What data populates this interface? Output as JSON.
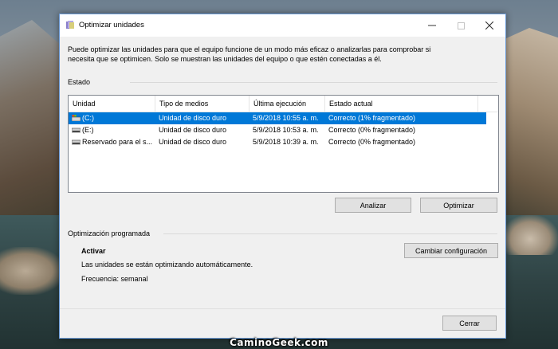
{
  "window": {
    "title": "Optimizar unidades",
    "description": "Puede optimizar las unidades para que el equipo funcione de un modo más eficaz o analizarlas para comprobar si necesita que se optimicen. Solo se muestran las unidades del equipo o que estén conectadas a él."
  },
  "status": {
    "label": "Estado",
    "columns": [
      "Unidad",
      "Tipo de medios",
      "Última ejecución",
      "Estado actual"
    ],
    "rows": [
      {
        "unit": "(C:)",
        "media": "Unidad de disco duro",
        "last_run": "5/9/2018 10:55 a. m.",
        "state": "Correcto (1% fragmentado)",
        "icon": "windows-drive-icon"
      },
      {
        "unit": "(E:)",
        "media": "Unidad de disco duro",
        "last_run": "5/9/2018 10:53 a. m.",
        "state": "Correcto (0% fragmentado)",
        "icon": "drive-icon"
      },
      {
        "unit": "Reservado para el s...",
        "media": "Unidad de disco duro",
        "last_run": "5/9/2018 10:39 a. m.",
        "state": "Correcto (0% fragmentado)",
        "icon": "drive-icon"
      }
    ],
    "selected_row": 0
  },
  "buttons": {
    "analyze": "Analizar",
    "optimize": "Optimizar",
    "change_config": "Cambiar configuración",
    "close": "Cerrar"
  },
  "scheduled": {
    "label": "Optimización programada",
    "state": "Activar",
    "info": "Las unidades se están optimizando automáticamente.",
    "frequency": "Frecuencia: semanal"
  },
  "watermark": "CaminoGeek.com",
  "colors": {
    "selection": "#0078d7",
    "window_border": "#6b9bd8"
  }
}
